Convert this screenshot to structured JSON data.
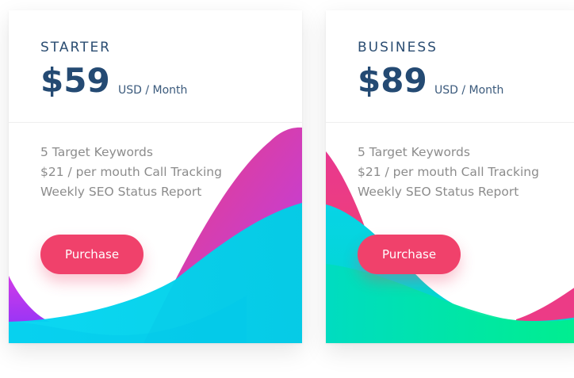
{
  "cards": [
    {
      "plan": "STARTER",
      "price": "$59",
      "period": "USD / Month",
      "features": [
        "5 Target Keywords",
        "$21 / per mouth Call Tracking",
        "Weekly SEO Status Report"
      ],
      "button": "Purchase"
    },
    {
      "plan": "BUSINESS",
      "price": "$89",
      "period": "USD / Month",
      "features": [
        "5 Target Keywords",
        "$21 / per mouth Call Tracking",
        "Weekly SEO Status Report"
      ],
      "button": "Purchase"
    }
  ],
  "colors": {
    "accent": "#f0416b",
    "heading": "#244a73",
    "wave_pink": "#e8388f",
    "wave_purple": "#c22ee8",
    "wave_cyan": "#00d2f0",
    "wave_green": "#00e79b"
  }
}
